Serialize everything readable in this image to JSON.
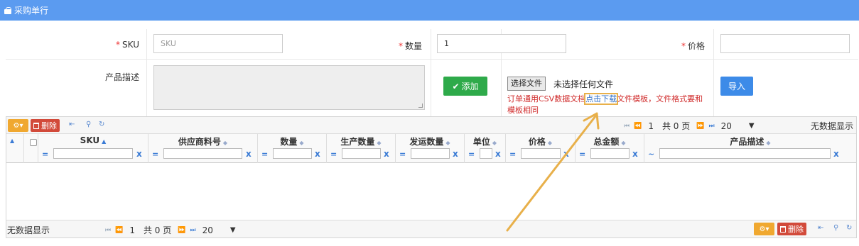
{
  "title": "采购单行",
  "form": {
    "sku_label": "SKU",
    "sku_placeholder": "SKU",
    "qty_label": "数量",
    "qty_value": "1",
    "price_label": "价格",
    "price_value": "",
    "desc_label": "产品描述",
    "add_label": "添加",
    "file_button": "选择文件",
    "file_status": "未选择任何文件",
    "note_before": "订单通用CSV数据文档",
    "note_link": "点击下载",
    "note_after": "文件模板，文件格式要和模板相同",
    "import_label": "导入",
    "required_mark": "*"
  },
  "grid": {
    "delete_label": "删除",
    "no_data": "无数据显示",
    "page_value": "1",
    "total_pages": "共 0 页",
    "page_size": "20",
    "columns": [
      {
        "label": "SKU",
        "filter_op": "=",
        "sorted": "asc"
      },
      {
        "label": "供应商料号",
        "filter_op": "="
      },
      {
        "label": "数量",
        "filter_op": "="
      },
      {
        "label": "生产数量",
        "filter_op": "="
      },
      {
        "label": "发运数量",
        "filter_op": "="
      },
      {
        "label": "单位",
        "filter_op": "="
      },
      {
        "label": "价格",
        "filter_op": "="
      },
      {
        "label": "总金额",
        "filter_op": "="
      },
      {
        "label": "产品描述",
        "filter_op": "~"
      }
    ],
    "clear_filter": "x"
  },
  "colors": {
    "titlebar": "#5b9bf0",
    "add_button": "#2eaa4a",
    "import_button": "#3d8be8",
    "delete_button": "#d24a3a",
    "gear_button": "#f0a830",
    "note_text": "#d02b2b",
    "annotation_arrow": "#e8b04a"
  }
}
